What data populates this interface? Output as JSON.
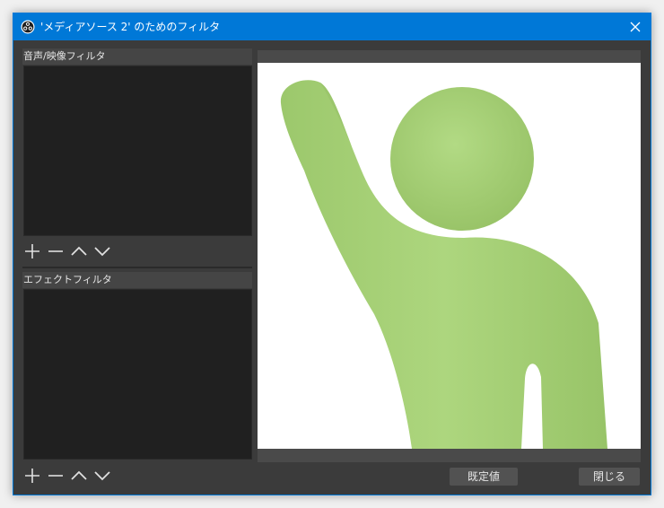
{
  "window": {
    "title": "'メディアソース 2' のためのフィルタ"
  },
  "icons": {
    "app": "obs-logo-icon",
    "close": "close-icon",
    "add": "plus-icon",
    "remove": "minus-icon",
    "up": "chevron-up-icon",
    "down": "chevron-down-icon"
  },
  "audio_video_filters": {
    "header": "音声/映像フィルタ",
    "items": []
  },
  "effect_filters": {
    "header": "エフェクトフィルタ",
    "items": []
  },
  "buttons": {
    "defaults": "既定値",
    "close": "閉じる"
  },
  "colors": {
    "titlebar": "#0078d7",
    "window_bg": "#3b3b3b",
    "list_bg": "#202020",
    "button_bg": "#525252",
    "figure_green": "#a8d27a"
  }
}
